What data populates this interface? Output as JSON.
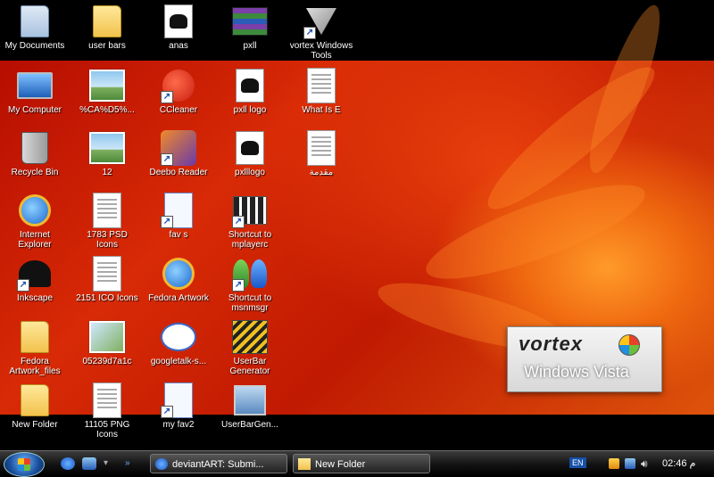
{
  "desktop": {
    "icons": [
      {
        "label": "My Documents"
      },
      {
        "label": "user bars"
      },
      {
        "label": "anas"
      },
      {
        "label": "pxll"
      },
      {
        "label": "vortex Windows Tools"
      },
      {
        "label": "My Computer"
      },
      {
        "label": "%CA%D5%..."
      },
      {
        "label": "CCleaner"
      },
      {
        "label": "pxll logo"
      },
      {
        "label": "What Is E"
      },
      {
        "label": "Recycle Bin"
      },
      {
        "label": "12"
      },
      {
        "label": "Deebo Reader"
      },
      {
        "label": "pxlllogo"
      },
      {
        "label": "مقدمة"
      },
      {
        "label": "Internet Explorer"
      },
      {
        "label": "1783 PSD Icons"
      },
      {
        "label": "fav s"
      },
      {
        "label": "Shortcut to mplayerc"
      },
      {
        "label": "Inkscape"
      },
      {
        "label": "2151 ICO Icons"
      },
      {
        "label": "Fedora Artwork"
      },
      {
        "label": "Shortcut to msnmsgr"
      },
      {
        "label": "Fedora Artwork_files"
      },
      {
        "label": "05239d7a1c"
      },
      {
        "label": "googletalk-s..."
      },
      {
        "label": "UserBar Generator"
      },
      {
        "label": "New Folder"
      },
      {
        "label": "11105 PNG Icons"
      },
      {
        "label": "my fav2"
      },
      {
        "label": "UserBarGen..."
      }
    ],
    "wallpaper_logo": {
      "line1": "vortex",
      "line2": "Windows Vista"
    }
  },
  "taskbar": {
    "tasks": [
      {
        "label": "deviantART: Submi..."
      },
      {
        "label": "New Folder"
      }
    ],
    "tray": {
      "language": "EN",
      "clock": "02:46 م"
    }
  },
  "colors": {
    "wallpaper": "#d82a06",
    "taskbar": "#121212"
  }
}
